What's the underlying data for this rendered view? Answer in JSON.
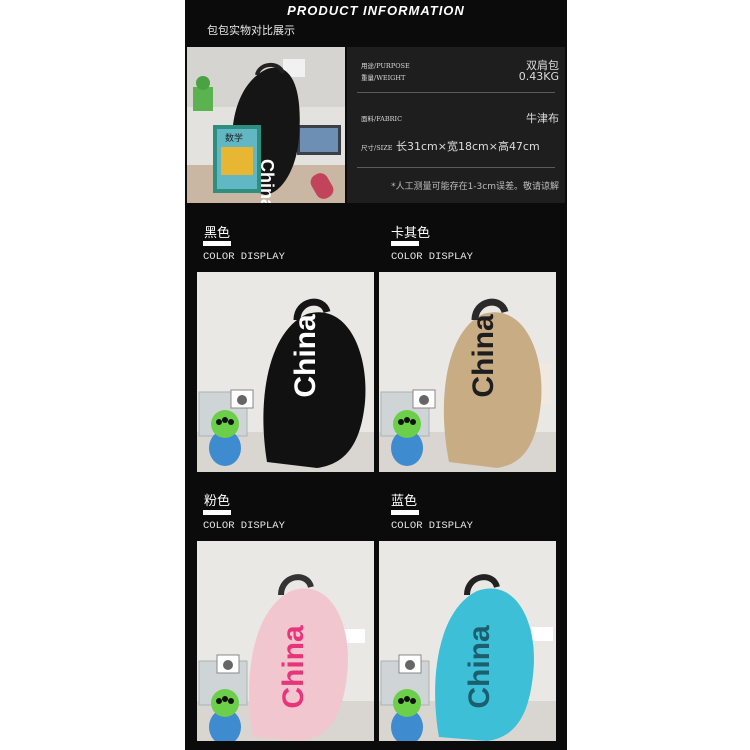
{
  "header": {
    "title": "PRODUCT INFORMATION",
    "subtitle": "包包实物对比展示"
  },
  "specs": {
    "purpose_label": "用途/PURPOSE",
    "purpose_value": "双肩包",
    "weight_label": "重量/WEIGHT",
    "weight_value": "0.43KG",
    "fabric_label": "面料/FABRIC",
    "fabric_value": "牛津布",
    "size_label": "尺寸/SIZE",
    "size_value": "长31cm×宽18cm×高47cm",
    "note": "*人工测量可能存在1-3cm误差。敬请谅解"
  },
  "photo": {
    "book_title": "数学",
    "bag_text": "China"
  },
  "colors": [
    {
      "name": "黑色",
      "display": "COLOR DISPLAY",
      "bag_text": "China",
      "bag_color": "#111111",
      "text_color": "#ffffff"
    },
    {
      "name": "卡其色",
      "display": "COLOR DISPLAY",
      "bag_text": "China",
      "bag_color": "#c8ad84",
      "text_color": "#1e1e1e"
    },
    {
      "name": "粉色",
      "display": "COLOR DISPLAY",
      "bag_text": "China",
      "bag_color": "#f2c6cf",
      "text_color": "#e8347a"
    },
    {
      "name": "蓝色",
      "display": "COLOR DISPLAY",
      "bag_text": "China",
      "bag_color": "#3dbfd8",
      "text_color": "#1b5f6e"
    }
  ]
}
